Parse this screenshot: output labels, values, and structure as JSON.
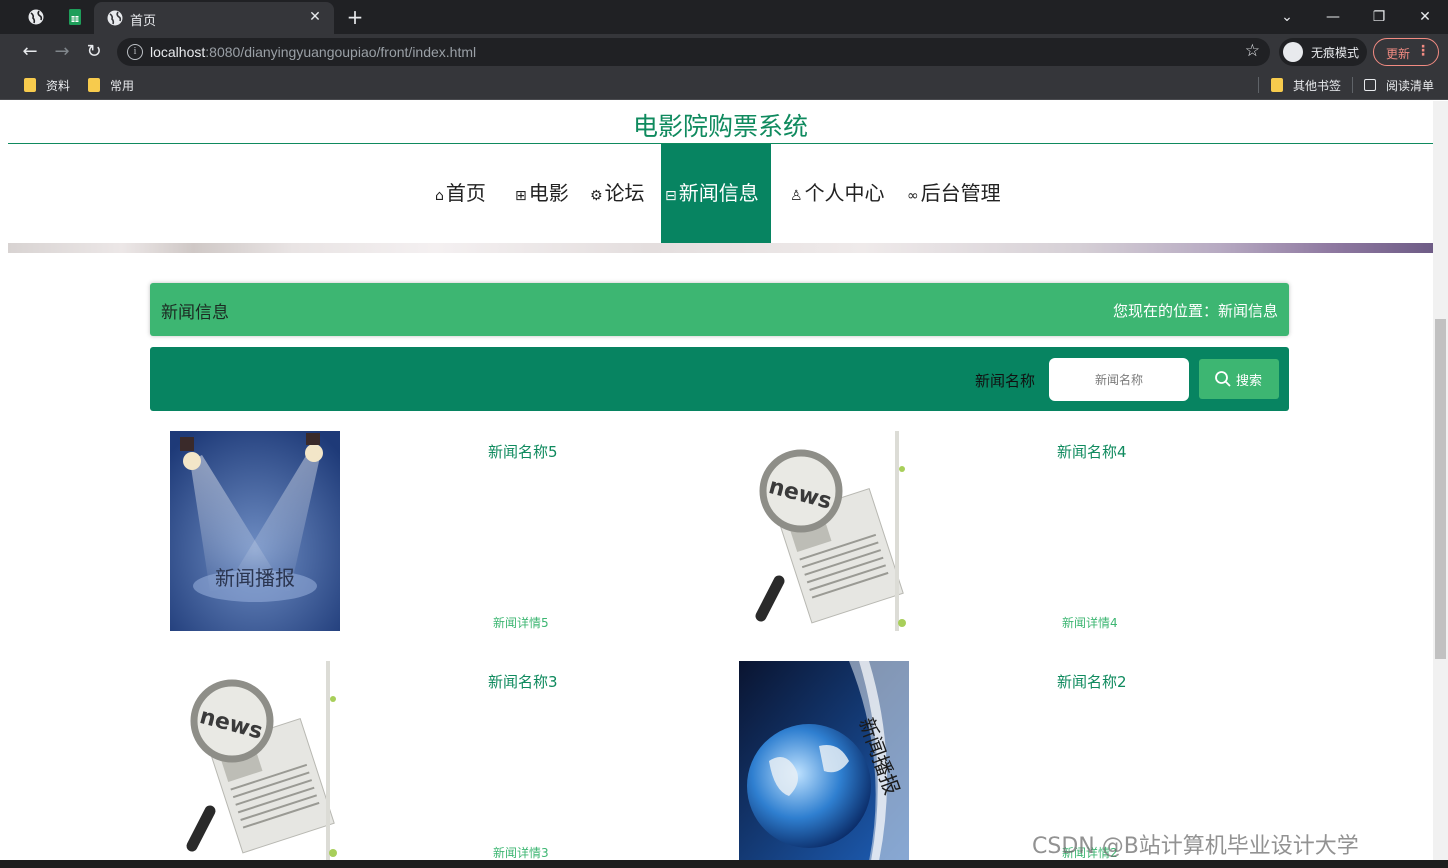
{
  "browser": {
    "tab_title": "首页",
    "url_host": "localhost",
    "url_rest": ":8080/dianyingyuangoupiao/front/index.html",
    "incognito_label": "无痕模式",
    "update_label": "更新",
    "bookmarks": [
      "资料",
      "常用"
    ],
    "other_bookmarks": "其他书签",
    "reading_list": "阅读清单"
  },
  "site": {
    "title": "电影院购票系统",
    "nav": [
      {
        "label": "首页",
        "icon": "home-icon"
      },
      {
        "label": "电影",
        "icon": "gift-icon"
      },
      {
        "label": "论坛",
        "icon": "gear-icon"
      },
      {
        "label": "新闻信息",
        "icon": "book-icon"
      },
      {
        "label": "个人中心",
        "icon": "user-icon"
      },
      {
        "label": "后台管理",
        "icon": "link-icon"
      }
    ],
    "active_nav": "新闻信息",
    "accent_color": "#078461",
    "light_accent_color": "#3db672"
  },
  "breadcrumb": {
    "title": "新闻信息",
    "location": "您现在的位置：新闻信息"
  },
  "search": {
    "label": "新闻名称",
    "placeholder": "新闻名称",
    "button_label": "搜索"
  },
  "news": [
    {
      "name": "新闻名称5",
      "detail": "新闻详情5",
      "image": "spotlight-news-image",
      "image_text": "新闻播报"
    },
    {
      "name": "新闻名称4",
      "detail": "新闻详情4",
      "image": "magnifier-newspaper-image",
      "image_text": "news"
    },
    {
      "name": "新闻名称3",
      "detail": "新闻详情3",
      "image": "magnifier-newspaper-image",
      "image_text": "news"
    },
    {
      "name": "新闻名称2",
      "detail": "新闻详情2",
      "image": "globe-news-image",
      "image_text": "新闻播报"
    }
  ],
  "watermark": "CSDN @B站计算机毕业设计大学"
}
